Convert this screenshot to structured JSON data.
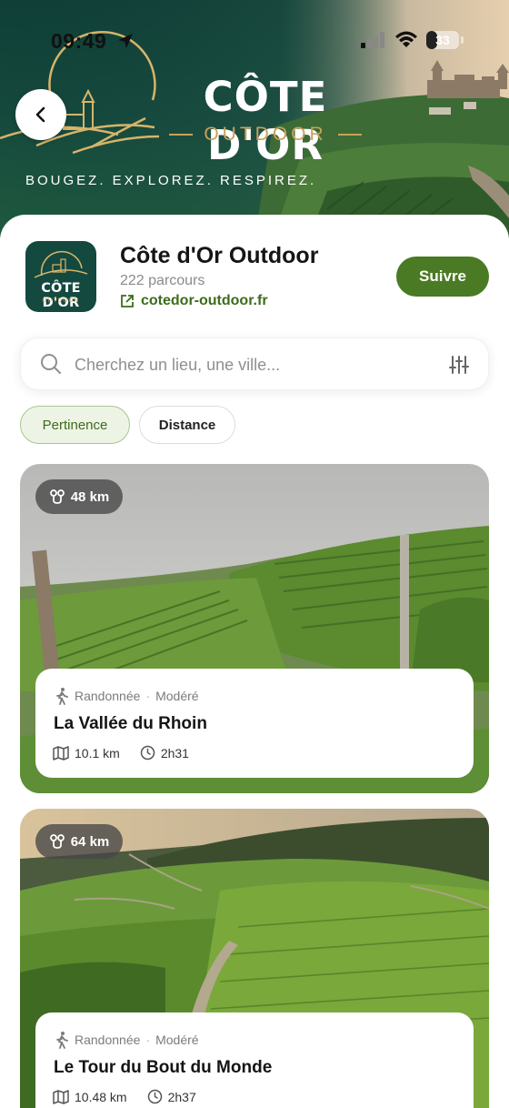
{
  "status_bar": {
    "time": "09:49",
    "battery": "33",
    "battery_level": 0.33
  },
  "header": {
    "title": "CÔTE D'OR",
    "subtitle": "OUTDOOR",
    "tagline": "BOUGEZ. EXPLOREZ. RESPIREZ."
  },
  "organization": {
    "name": "Côte d'Or Outdoor",
    "count": "222 parcours",
    "website": "cotedor-outdoor.fr",
    "follow_label": "Suivre",
    "logo_title": "CÔTE D'OR",
    "logo_sub": "OUTDOOR"
  },
  "search": {
    "placeholder": "Cherchez un lieu, une ville..."
  },
  "sort_chips": [
    {
      "label": "Pertinence",
      "active": true
    },
    {
      "label": "Distance",
      "active": false
    }
  ],
  "trails": [
    {
      "distance_badge": "48 km",
      "activity": "Randonnée",
      "difficulty": "Modéré",
      "title": "La Vallée du Rhoin",
      "length": "10.1 km",
      "duration": "2h31"
    },
    {
      "distance_badge": "64 km",
      "activity": "Randonnée",
      "difficulty": "Modéré",
      "title": "Le Tour du Bout du Monde",
      "length": "10.48 km",
      "duration": "2h37"
    }
  ],
  "colors": {
    "primary": "#4a7a23",
    "dark_green": "#14493f",
    "gold": "#c9a15a"
  }
}
